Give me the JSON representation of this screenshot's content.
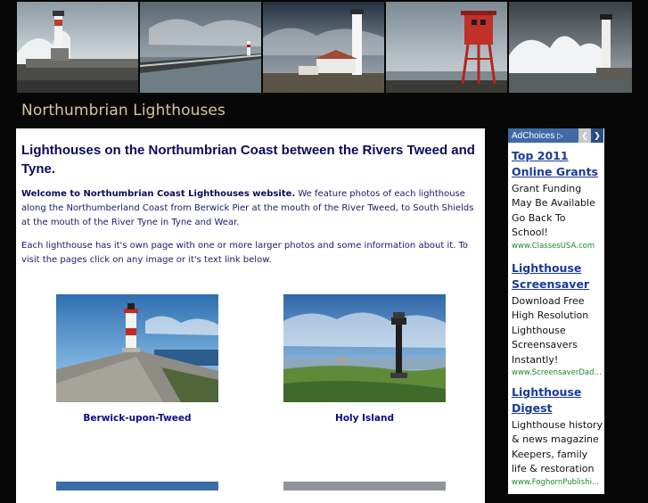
{
  "site": {
    "title": "Northumbrian Lighthouses"
  },
  "banner": {
    "photos": [
      "lighthouse-photo-1",
      "lighthouse-photo-2",
      "lighthouse-photo-3",
      "lighthouse-photo-4",
      "lighthouse-photo-5"
    ]
  },
  "main": {
    "heading": "Lighthouses on the Northumbrian Coast between the Rivers Tweed and Tyne.",
    "welcome_bold": "Welcome to Northumbrian Coast Lighthouses website.",
    "welcome_text": " We feature photos of each lighthouse along the Northumberland Coast from Berwick Pier at the mouth of the River Tweed, to South Shields at the mouth of the River Tyne in Tyne and Wear.",
    "intro": "Each lighthouse has it's own page with one or more larger photos and some information about it. To visit the pages click on any image or it's text link below.",
    "lighthouses": [
      {
        "name": "Berwick-upon-Tweed"
      },
      {
        "name": "Holy Island"
      }
    ]
  },
  "ads": {
    "choices_label": "AdChoices",
    "prev_icon": "chevron-left-icon",
    "next_icon": "chevron-right-icon",
    "items": [
      {
        "title_line1": "Top 2011",
        "title_line2": "Online Grants",
        "body": "Grant Funding May Be Available Go Back To School!",
        "url": "www.ClassesUSA.com"
      },
      {
        "title_line1": "Lighthouse",
        "title_line2": "Screensaver",
        "body": "Download Free High Resolution Lighthouse Screensavers Instantly!",
        "url": "www.ScreensaverDad..."
      },
      {
        "title_line1": "Lighthouse",
        "title_line2": "Digest",
        "body": "Lighthouse history & news magazine Keepers, family life & restoration",
        "url": "www.FoghornPublishi..."
      }
    ]
  },
  "colors": {
    "page_background": "#070707",
    "title_text": "#d7c598",
    "heading_text": "#0b0b5a",
    "ad_choices_bg": "#3f6aa6",
    "ad_url": "#1b8a2a"
  }
}
